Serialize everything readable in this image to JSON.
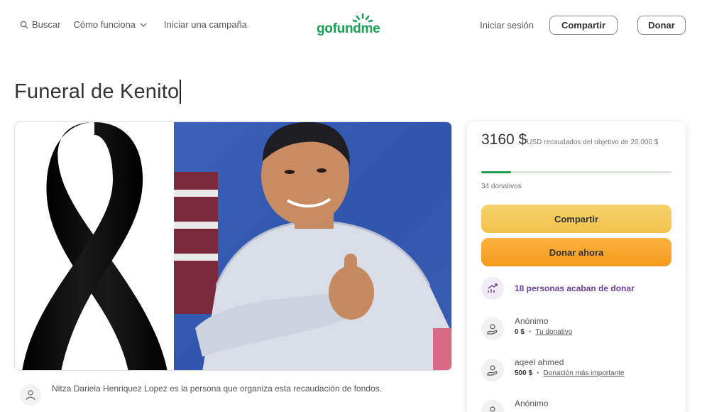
{
  "header": {
    "search_label": "Buscar",
    "how_it_works_label": "Cómo funciona",
    "start_campaign_label": "Iniciar una campaña",
    "logo_text": "gofundme",
    "signin_label": "Iniciar sesión",
    "share_label": "Compartir",
    "donate_label": "Donar"
  },
  "campaign": {
    "title": "Funeral de Kenito",
    "organizer_text": "Nitza Dariela Henriquez Lopez es la persona que organiza esta recaudación de fondos."
  },
  "sidebar": {
    "amount": "3160 $",
    "amount_detail": "USD recaudados del objetivo de 20.000 $",
    "progress_fraction": 0.158,
    "donations_count": "34 donativos",
    "share_label": "Compartir",
    "donate_label": "Donar ahora",
    "recent_label": "18 personas acaban de donar",
    "donors": [
      {
        "name": "Anónimo",
        "amount": "0 $",
        "tag": "Tu donativo"
      },
      {
        "name": "aqeel ahmed",
        "amount": "500 $",
        "tag": "Donación más importante"
      },
      {
        "name": "Anónimo",
        "amount": "",
        "tag": ""
      }
    ]
  },
  "colors": {
    "brand_green": "#1aa052",
    "share_yellow": "#f2c14a",
    "donate_orange": "#f59c1c",
    "accent_purple": "#6b3fa0"
  },
  "icons": {
    "search": "search-icon",
    "chevron": "chevron-down-icon",
    "organizer": "user-icon",
    "trending": "trending-up-icon",
    "donor": "donor-hand-icon"
  }
}
